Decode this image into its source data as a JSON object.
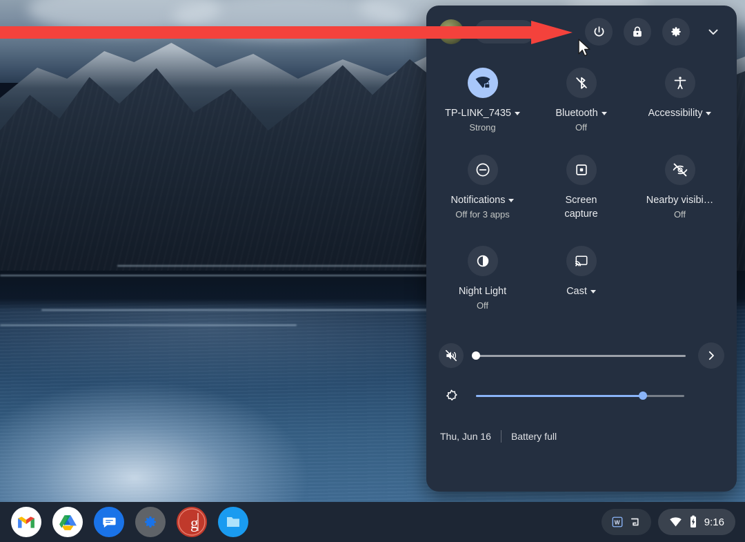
{
  "desktop": {
    "wallpaper_description": "dark blue mountain fjord at dusk with snow-capped peaks and rippled water",
    "background_color": "#0c1420"
  },
  "annotation": {
    "type": "arrow",
    "color": "#f4423c",
    "points_to": "power-button"
  },
  "quick_settings": {
    "top_bar": {
      "avatar_name": "avatar",
      "sign_out_label": "Sign out",
      "power_icon": "power-icon",
      "lock_icon": "lock-icon",
      "settings_icon": "gear-icon",
      "collapse_icon": "chevron-down-icon"
    },
    "tiles": [
      [
        {
          "icon": "wifi-lock-icon",
          "label": "TP-LINK_7435",
          "sublabel": "Strong",
          "has_caret": true,
          "active": true
        },
        {
          "icon": "bluetooth-off-icon",
          "label": "Bluetooth",
          "sublabel": "Off",
          "has_caret": true,
          "active": false
        },
        {
          "icon": "accessibility-icon",
          "label": "Accessibility",
          "sublabel": "",
          "has_caret": true,
          "active": false
        }
      ],
      [
        {
          "icon": "do-not-disturb-icon",
          "label": "Notifications",
          "sublabel": "Off for 3 apps",
          "has_caret": true,
          "active": false
        },
        {
          "icon": "screen-capture-icon",
          "label": "Screen capture",
          "sublabel": "",
          "has_caret": false,
          "active": false
        },
        {
          "icon": "nearby-visibility-off-icon",
          "label": "Nearby visibi…",
          "sublabel": "Off",
          "has_caret": false,
          "active": false
        }
      ],
      [
        {
          "icon": "night-light-icon",
          "label": "Night Light",
          "sublabel": "Off",
          "has_caret": false,
          "active": false
        },
        {
          "icon": "cast-icon",
          "label": "Cast",
          "sublabel": "",
          "has_caret": true,
          "active": false
        }
      ]
    ],
    "sliders": [
      {
        "name": "volume",
        "icon": "volume-muted-icon",
        "value": 0,
        "accent": "#ffffff",
        "trailing_icon": "chevron-right-icon"
      },
      {
        "name": "brightness",
        "icon": "brightness-icon",
        "value": 80,
        "accent": "#8ab4f8",
        "trailing_icon": ""
      }
    ],
    "footer": {
      "date": "Thu, Jun 16",
      "battery_status": "Battery full"
    }
  },
  "shelf": {
    "apps": [
      {
        "name": "gmail",
        "label": "Gmail"
      },
      {
        "name": "google-drive",
        "label": "Google Drive"
      },
      {
        "name": "messages",
        "label": "Messages"
      },
      {
        "name": "settings",
        "label": "Settings"
      },
      {
        "name": "groovypost",
        "label": "g"
      },
      {
        "name": "files",
        "label": "Files"
      }
    ],
    "tray": [
      {
        "name": "word-badge-icon",
        "label": "W"
      },
      {
        "name": "tote-icon",
        "label": ""
      }
    ],
    "status": {
      "wifi_icon": "wifi-icon",
      "battery_icon": "battery-charging-icon",
      "time": "9:16"
    }
  }
}
